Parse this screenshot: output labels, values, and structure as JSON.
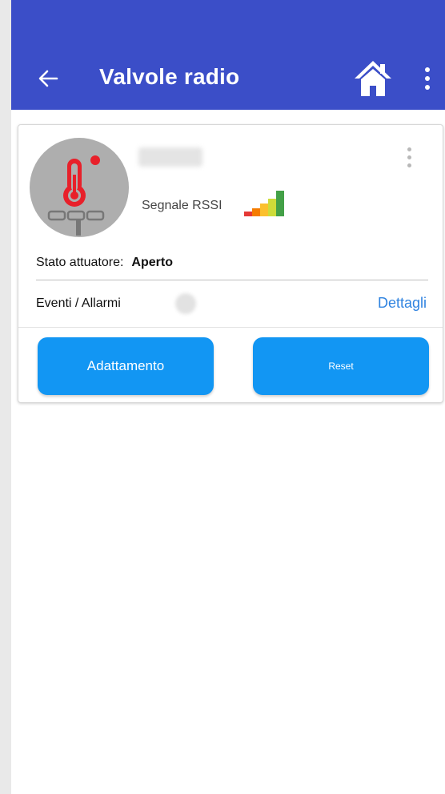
{
  "appbar": {
    "title": "Valvole radio",
    "back_icon": "arrow-left-icon",
    "home_icon": "home-icon",
    "menu_icon": "more-vertical-icon",
    "background_color": "#3b4ec8"
  },
  "device": {
    "avatar_icon": "thermostat-valve-icon",
    "name": "",
    "menu_icon": "more-vertical-icon",
    "rssi_label": "Segnale RSSI",
    "rssi_icon": "signal-strength-icon",
    "state_label": "Stato attuatore:",
    "state_value": "Aperto",
    "events_label": "Eventi / Allarmi",
    "events_icon": "alarm-status-icon",
    "details_link": "Dettagli"
  },
  "actions": {
    "adapt_label": "Adattamento",
    "reset_label": "Reset",
    "button_color": "#1296f3"
  },
  "colors": {
    "link": "#2f83e0",
    "thermometer": "#e8202a",
    "signal": [
      "#e53935",
      "#f57c00",
      "#fbc02d",
      "#cddc39",
      "#43a047"
    ]
  }
}
